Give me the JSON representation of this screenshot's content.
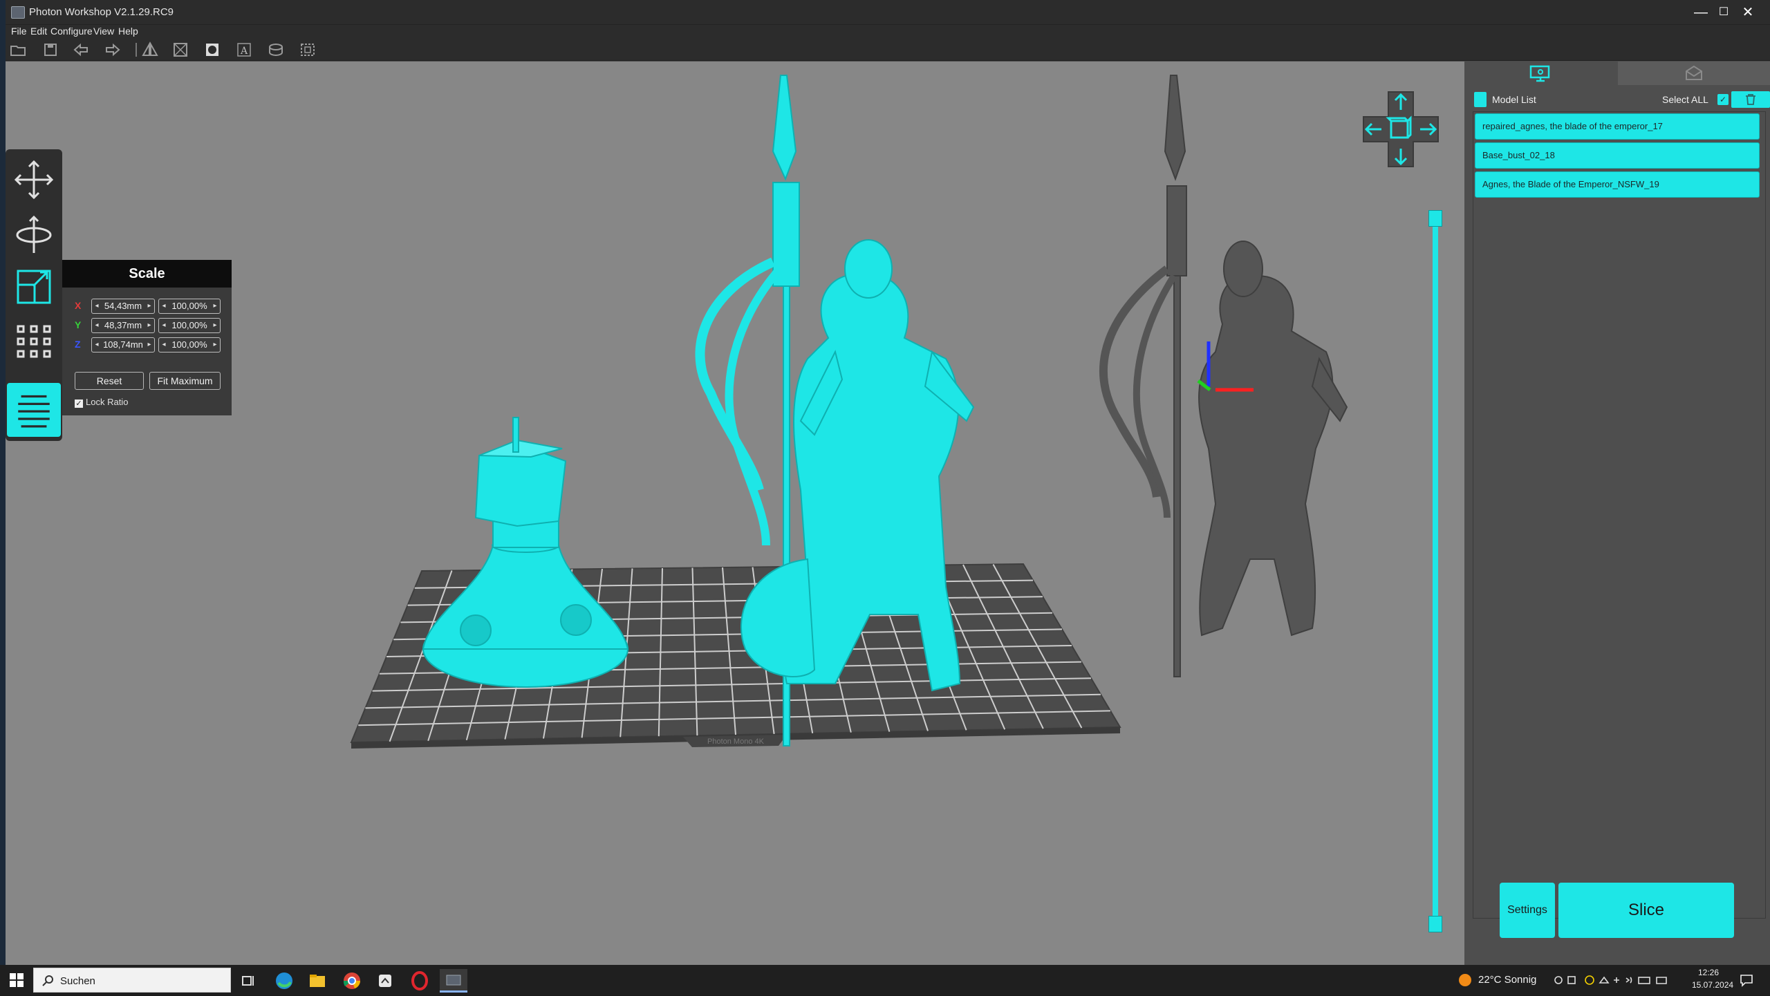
{
  "window": {
    "title": "Photon Workshop V2.1.29.RC9",
    "controls": {
      "minimize": "—",
      "maximize": "☐",
      "close": "✕"
    }
  },
  "menu": [
    "File",
    "Edit",
    "Configure",
    "View",
    "Help"
  ],
  "toolbar_icons": [
    "open-file-icon",
    "save-icon",
    "undo-icon",
    "redo-icon",
    "mirror-icon",
    "hollow-icon",
    "punch-hole-icon",
    "text-icon",
    "repair-icon",
    "crop-icon"
  ],
  "left_tools": [
    "move-icon",
    "rotate-icon",
    "scale-icon",
    "arrange-icon",
    "layers-icon"
  ],
  "scale_panel": {
    "title": "Scale",
    "rows": [
      {
        "axis": "X",
        "axis_color": "#e23a3a",
        "size": "54,43mm",
        "percent": "100,00%"
      },
      {
        "axis": "Y",
        "axis_color": "#37d23a",
        "size": "48,37mm",
        "percent": "100,00%"
      },
      {
        "axis": "Z",
        "axis_color": "#3a55ff",
        "size": "108,74mn",
        "percent": "100,00%"
      }
    ],
    "reset": "Reset",
    "fit_maximum": "Fit Maximum",
    "lock_ratio": "Lock Ratio",
    "lock_ratio_checked": true
  },
  "build_plate_label": "Photon Mono 4K",
  "right_panel": {
    "model_list_label": "Model List",
    "select_all_label": "Select ALL",
    "select_all_checked": true,
    "models": [
      "repaired_agnes, the blade of the emperor_17",
      "Base_bust_02_18",
      "Agnes, the Blade of the Emperor_NSFW_19"
    ],
    "settings_label": "Settings",
    "slice_label": "Slice"
  },
  "accent_color": "#1ee6e6",
  "taskbar": {
    "search_placeholder": "Suchen",
    "weather": "22°C  Sonnig",
    "time": "12:26",
    "date": "15.07.2024"
  }
}
